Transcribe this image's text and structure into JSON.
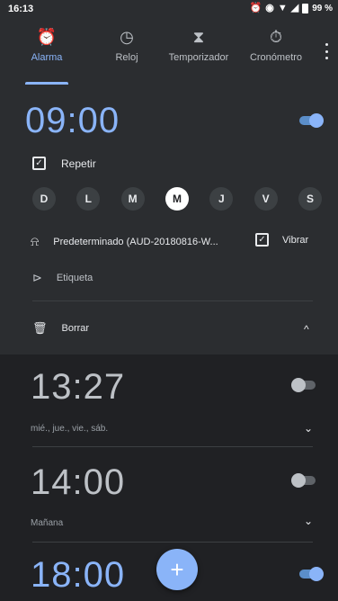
{
  "status": {
    "time": "16:13",
    "battery": "99 %"
  },
  "tabs": [
    {
      "label": "Alarma",
      "icon": "alarm-icon",
      "active": true
    },
    {
      "label": "Reloj",
      "icon": "clock-icon"
    },
    {
      "label": "Temporizador",
      "icon": "hourglass-icon"
    },
    {
      "label": "Cronómetro",
      "icon": "stopwatch-icon"
    }
  ],
  "alarms": [
    {
      "time": "09:00",
      "enabled": true,
      "expanded": true,
      "repeat_label": "Repetir",
      "days": [
        "D",
        "L",
        "M",
        "M",
        "J",
        "V",
        "S"
      ],
      "selected_day_index": 3,
      "sound": "Predeterminado (AUD-20180816-W...",
      "vibrate_label": "Vibrar",
      "label_placeholder": "Etiqueta",
      "delete_label": "Borrar"
    },
    {
      "time": "13:27",
      "enabled": false,
      "subtitle": "mié., jue., vie., sáb."
    },
    {
      "time": "14:00",
      "enabled": false,
      "subtitle": "Mañana"
    },
    {
      "time": "18:00",
      "enabled": true
    }
  ],
  "fab": {
    "label": "+"
  },
  "colors": {
    "accent": "#8ab4f8",
    "background": "#202124",
    "surface": "#2b2d30"
  }
}
